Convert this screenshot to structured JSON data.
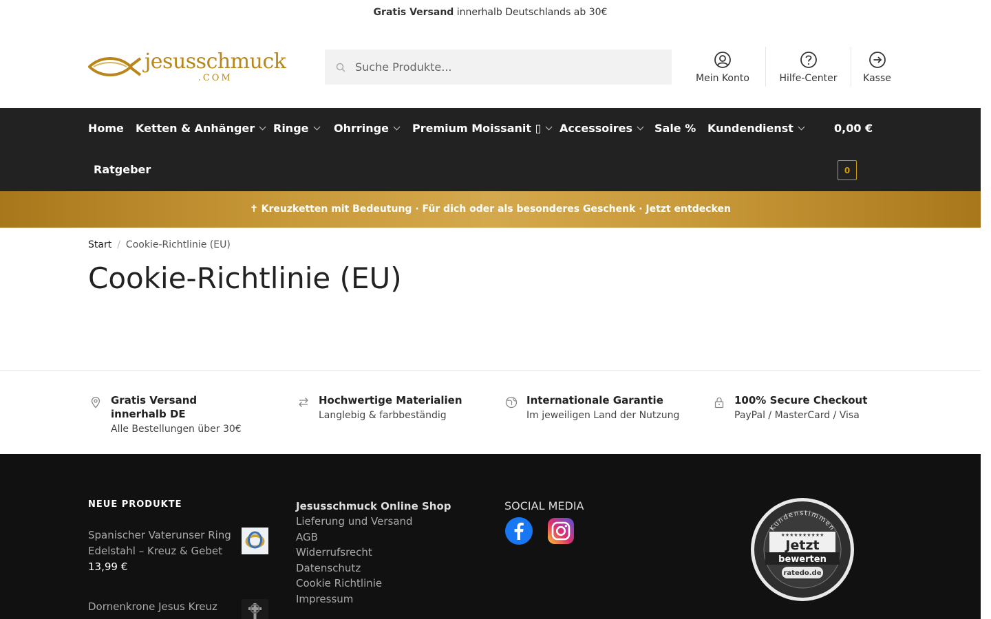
{
  "topbar": {
    "bold": "Gratis Versand",
    "rest": " innerhalb Deutschlands ab 30€"
  },
  "logo": {
    "word": "jesusschmuck",
    "com": ".COM"
  },
  "search": {
    "placeholder": "Suche Produkte..."
  },
  "header_links": [
    {
      "label": "Mein Konto",
      "icon": "user-circle-icon"
    },
    {
      "label": "Hilfe-Center",
      "icon": "help-circle-icon"
    },
    {
      "label": "Kasse",
      "icon": "arrow-circle-icon"
    }
  ],
  "nav": {
    "items": [
      {
        "label": "Home",
        "dropdown": false
      },
      {
        "label": "Ketten & Anhänger",
        "dropdown": true
      },
      {
        "label": "Ringe",
        "dropdown": true
      },
      {
        "label": "Ohrringe",
        "dropdown": true
      },
      {
        "label": "Premium Moissanit ▯",
        "dropdown": true
      },
      {
        "label": "Accessoires",
        "dropdown": true
      },
      {
        "label": "Sale %",
        "dropdown": false
      },
      {
        "label": "Kundendienst",
        "dropdown": true
      },
      {
        "label": "Ratgeber",
        "dropdown": false
      }
    ],
    "cart_total": "0,00 €",
    "cart_count": "0"
  },
  "promo": {
    "text": "✝ Kreuzketten mit Bedeutung · Für dich oder als besonderes Geschenk · Jetzt entdecken"
  },
  "breadcrumb": {
    "home": "Start",
    "current": "Cookie-Richtlinie (EU)"
  },
  "page_title": "Cookie-Richtlinie (EU)",
  "usps": [
    {
      "title": "Gratis Versand innerhalb DE",
      "sub": "Alle Bestellungen über 30€",
      "icon": "location-pin-icon"
    },
    {
      "title": "Hochwertige Materialien",
      "sub": "Langlebig & farbbeständig",
      "icon": "swap-arrows-icon"
    },
    {
      "title": "Internationale Garantie",
      "sub": "Im jeweiligen Land der Nutzung",
      "icon": "globe-icon"
    },
    {
      "title": "100% Secure Checkout",
      "sub": "PayPal / MasterCard / Visa",
      "icon": "lock-icon"
    }
  ],
  "footer": {
    "new_products_heading": "NEUE PRODUKTE",
    "products": [
      {
        "name": "Spanischer Vaterunser Ring Edelstahl – Kreuz & Gebet",
        "price": "13,99 €"
      },
      {
        "name": "Dornenkrone Jesus Kreuz",
        "price": ""
      }
    ],
    "shop_heading": "Jesusschmuck Online Shop",
    "links": [
      "Lieferung und Versand",
      "AGB",
      "Widerrufsrecht",
      "Datenschutz",
      "Cookie Richtlinie",
      "Impressum"
    ],
    "social_heading": "SOCIAL MEDIA",
    "social": [
      "facebook-icon",
      "instagram-icon"
    ],
    "badge": {
      "top": "Kundenstimmen",
      "line1": "Jetzt",
      "line2": "bewerten",
      "brand": "ratedo.de"
    }
  },
  "colors": {
    "nav_bg": "#222222",
    "gold": "#b8861b",
    "footer_bg": "#111111",
    "cart_accent": "#d39e00"
  }
}
